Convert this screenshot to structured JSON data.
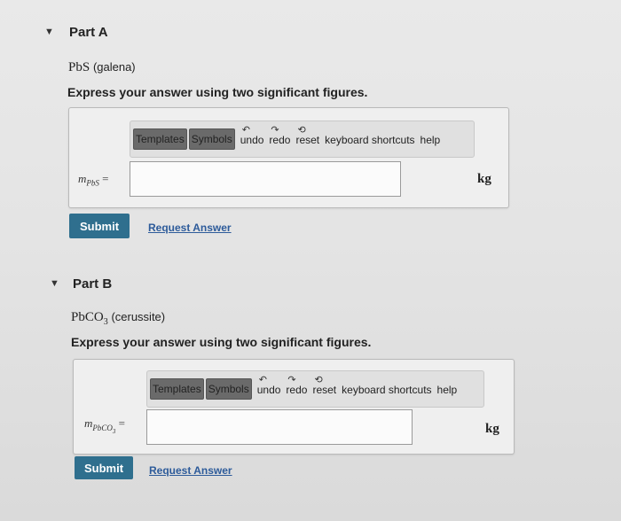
{
  "partA": {
    "title": "Part A",
    "formula": "PbS",
    "name": "(galena)",
    "instruction": "Express your answer using two significant figures.",
    "toolbar": {
      "templates": "Templates",
      "symbols": "Symbols",
      "undo": "undo",
      "redo": "redo",
      "reset": "reset",
      "shortcuts": "keyboard shortcuts",
      "help": "help"
    },
    "variable": "m",
    "variable_sub": "PbS",
    "equals": "=",
    "answer_value": "",
    "unit": "kg",
    "submit": "Submit",
    "request": "Request Answer"
  },
  "partB": {
    "title": "Part B",
    "formula_main": "PbCO",
    "formula_sub": "3",
    "name": "(cerussite)",
    "instruction": "Express your answer using two significant figures.",
    "toolbar": {
      "templates": "Templates",
      "symbols": "Symbols",
      "undo": "undo",
      "redo": "redo",
      "reset": "reset",
      "shortcuts": "keyboard shortcuts",
      "help": "help"
    },
    "variable": "m",
    "variable_sub": "PbCO",
    "variable_sub2": "3",
    "equals": "=",
    "answer_value": "",
    "unit": "kg",
    "submit": "Submit",
    "request": "Request Answer"
  }
}
